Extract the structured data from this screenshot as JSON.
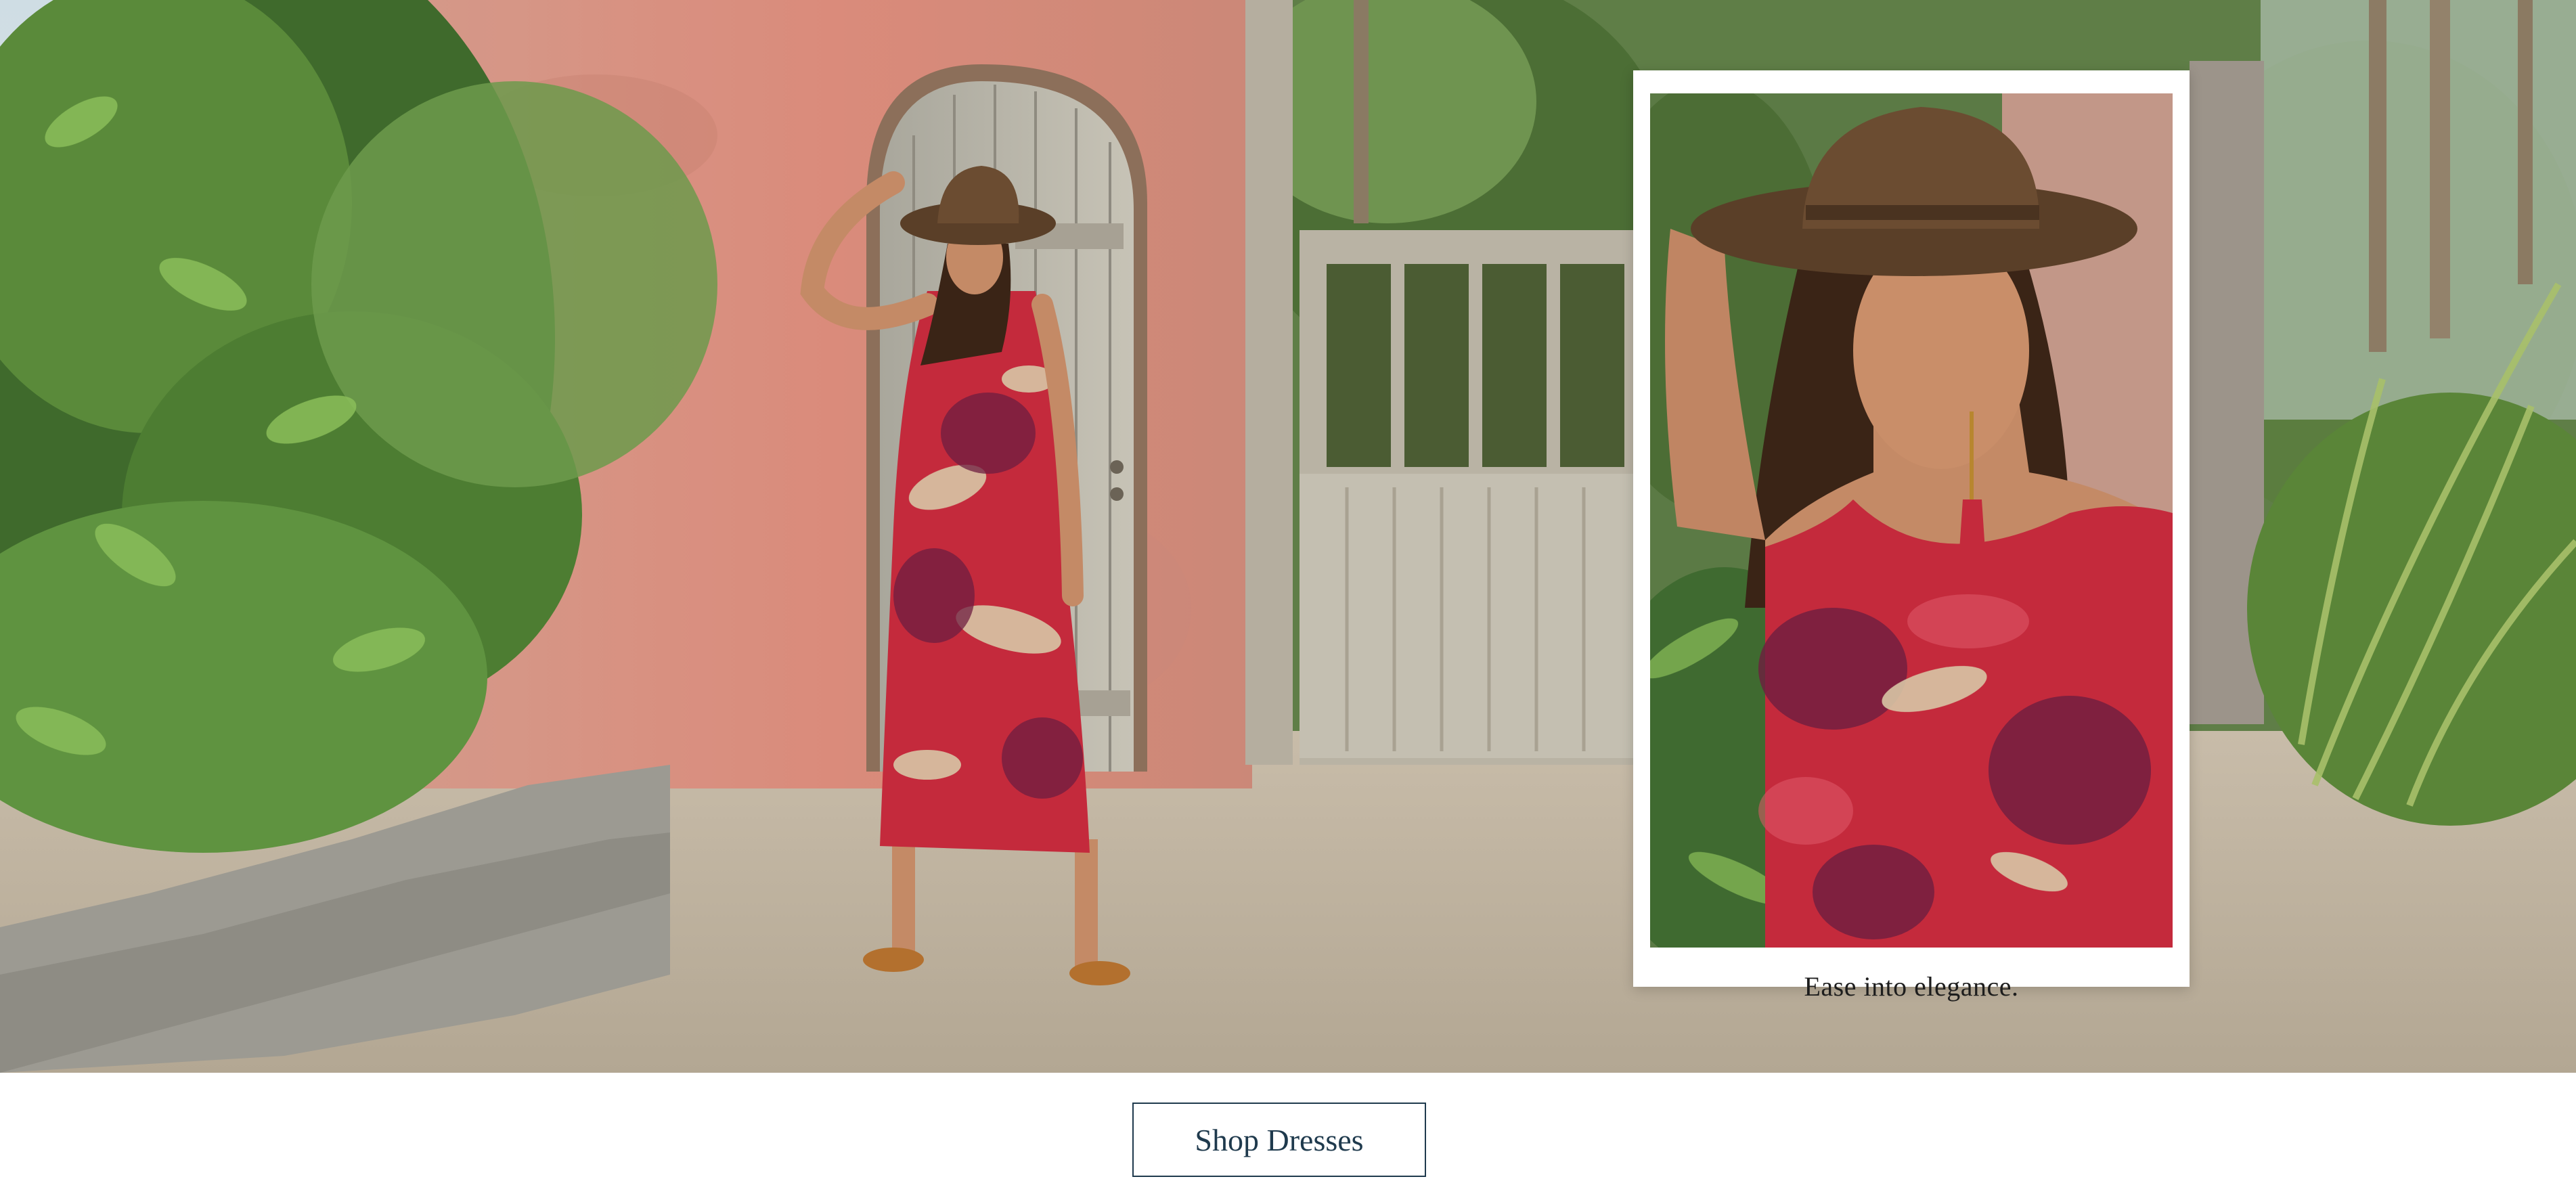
{
  "hero": {
    "card_caption": "Ease into elegance."
  },
  "cta": {
    "label": "Shop Dresses"
  },
  "colors": {
    "cta_text": "#1f3a4d",
    "cta_border": "#1f3a4d",
    "dress_red": "#c42a3c",
    "wall_pink": "#d98f82",
    "hat_brown": "#5a3f28"
  }
}
